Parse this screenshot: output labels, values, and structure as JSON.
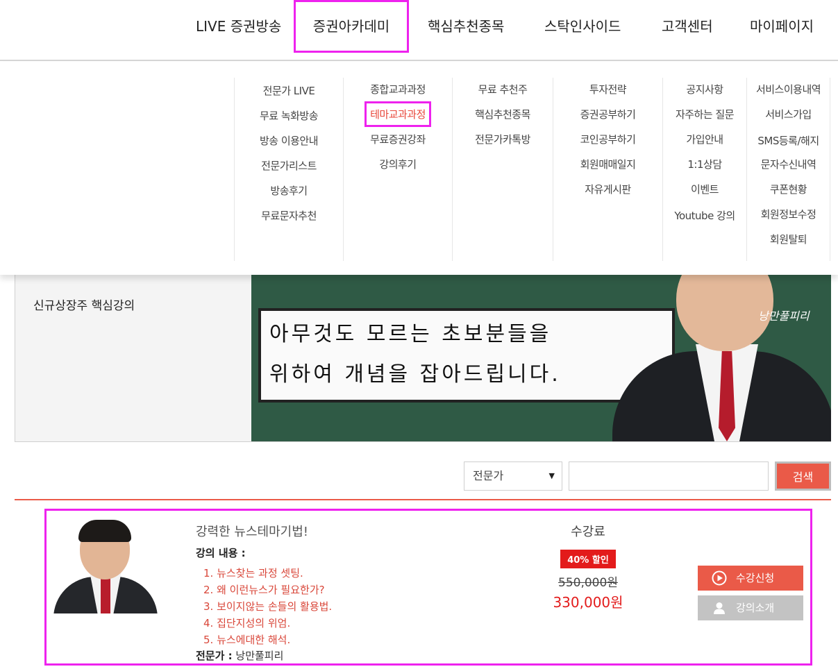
{
  "nav": {
    "items": [
      {
        "label": "LIVE 증권방송"
      },
      {
        "label": "증권아카데미"
      },
      {
        "label": "핵심추천종목"
      },
      {
        "label": "스탁인사이드"
      },
      {
        "label": "고객센터"
      },
      {
        "label": "마이페이지"
      }
    ],
    "active_index": 1
  },
  "menu": {
    "columns": [
      {
        "links": [
          "전문가 LIVE",
          "무료 녹화방송",
          "방송 이용안내",
          "전문가리스트",
          "방송후기",
          "무료문자추천"
        ]
      },
      {
        "links": [
          "종합교과과정",
          "테마교과과정",
          "무료증권강좌",
          "강의후기"
        ]
      },
      {
        "links": [
          "무료 추천주",
          "핵심추천종목",
          "전문가카톡방"
        ]
      },
      {
        "links": [
          "투자전략",
          "증권공부하기",
          "코인공부하기",
          "회원매매일지",
          "자유게시판"
        ]
      },
      {
        "links": [
          "공지사항",
          "자주하는 질문",
          "가입안내",
          "1:1상담",
          "이벤트",
          "Youtube 강의"
        ]
      },
      {
        "links": [
          "서비스이용내역",
          "서비스가입",
          "SMS등록/해지",
          "문자수신내역",
          "쿠폰현황",
          "회원정보수정",
          "회원탈퇴"
        ]
      }
    ],
    "active": "테마교과과정"
  },
  "banner": {
    "side_title": "신규상장주 핵심강의",
    "board_line1": "아무것도 모르는 초보분들을",
    "board_line2": "위하여 개념을 잡아드립니다.",
    "signature": "낭만풀피리"
  },
  "search": {
    "select_value": "전문가",
    "input_value": "",
    "button_label": "검색"
  },
  "course": {
    "title": "강력한 뉴스테마기법!",
    "content_label": "강의 내용 :",
    "items": [
      "1. 뉴스찾는 과정 셋팅.",
      "2. 왜 이런뉴스가 필요한가?",
      "3. 보이지않는 손들의 활용법.",
      "4. 집단지성의 위엄.",
      "5. 뉴스에대한 해석."
    ],
    "expert_label": "전문가 :",
    "expert_name": "낭만풀피리",
    "price_label": "수강료",
    "discount_badge": "40% 할인",
    "original_price": "550,000원",
    "sale_price": "330,000원",
    "apply_button": "수강신청",
    "intro_button": "강의소개"
  },
  "colors": {
    "accent": "#ea5a48",
    "highlight_link": "#e8473a",
    "price_red": "#e31b1b",
    "annotation_box": "#ee22ee"
  }
}
